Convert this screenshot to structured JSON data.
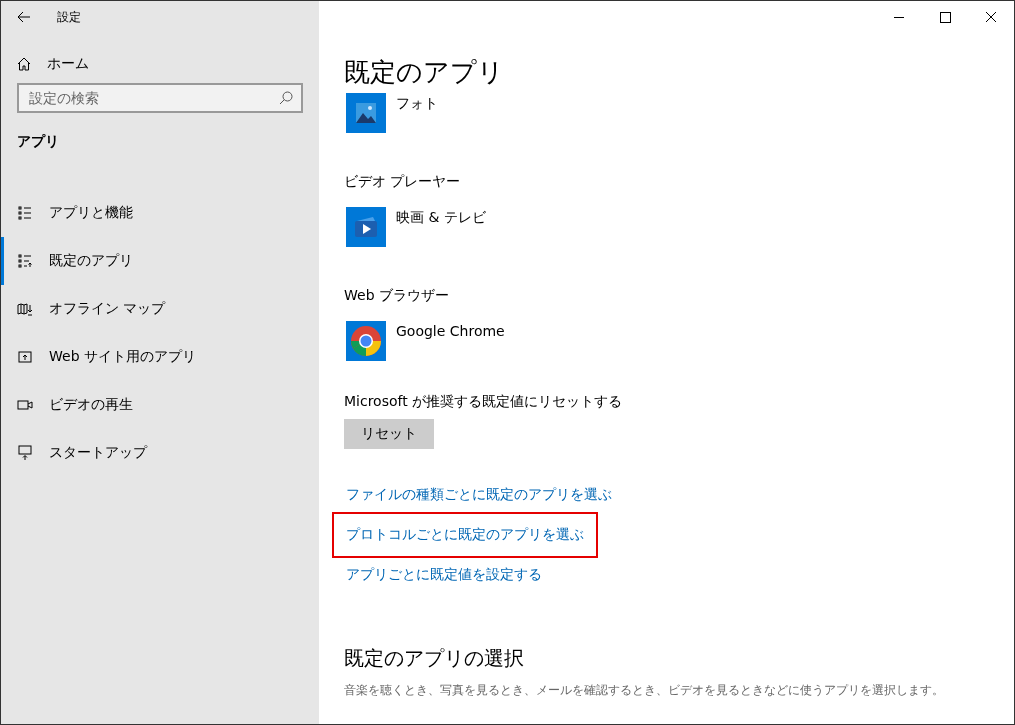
{
  "window": {
    "title": "設定"
  },
  "sidebar": {
    "home": "ホーム",
    "search": {
      "placeholder": "設定の検索"
    },
    "section": "アプリ",
    "items": [
      {
        "label": "アプリと機能",
        "kind": "list",
        "selected": false
      },
      {
        "label": "既定のアプリ",
        "kind": "defaults",
        "selected": true
      },
      {
        "label": "オフライン マップ",
        "kind": "map",
        "selected": false
      },
      {
        "label": "Web サイト用のアプリ",
        "kind": "web",
        "selected": false
      },
      {
        "label": "ビデオの再生",
        "kind": "video",
        "selected": false
      },
      {
        "label": "スタートアップ",
        "kind": "startup",
        "selected": false
      }
    ]
  },
  "main": {
    "title": "既定のアプリ",
    "groups": [
      {
        "app": {
          "name": "フォト",
          "kind": "photos"
        }
      },
      {
        "heading": "ビデオ プレーヤー",
        "app": {
          "name": "映画 & テレビ",
          "kind": "movies"
        }
      },
      {
        "heading": "Web ブラウザー",
        "app": {
          "name": "Google Chrome",
          "kind": "chrome"
        }
      }
    ],
    "reset_label": "Microsoft が推奨する既定値にリセットする",
    "reset_button": "リセット",
    "links": [
      {
        "label": "ファイルの種類ごとに既定のアプリを選ぶ",
        "highlighted": false
      },
      {
        "label": "プロトコルごとに既定のアプリを選ぶ",
        "highlighted": true
      },
      {
        "label": "アプリごとに既定値を設定する",
        "highlighted": false
      }
    ],
    "section_title": "既定のアプリの選択",
    "section_text": "音楽を聴くとき、写真を見るとき、メールを確認するとき、ビデオを見るときなどに使うアプリを選択します。"
  }
}
